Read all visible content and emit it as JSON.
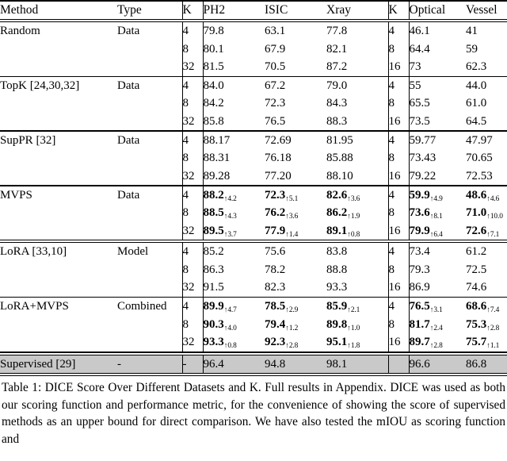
{
  "table": {
    "headers": [
      "Method",
      "Type",
      "K",
      "PH2",
      "ISIC",
      "Xray",
      "K",
      "Optical",
      "Vessel"
    ],
    "groups": [
      {
        "method": "Random",
        "type": "Data",
        "bold": false,
        "rows": [
          {
            "k1": "4",
            "ph2": "79.8",
            "isic": "63.1",
            "xray": "77.8",
            "k2": "4",
            "optical": "46.1",
            "vessel": "41"
          },
          {
            "k1": "8",
            "ph2": "80.1",
            "isic": "67.9",
            "xray": "82.1",
            "k2": "8",
            "optical": "64.4",
            "vessel": "59"
          },
          {
            "k1": "32",
            "ph2": "81.5",
            "isic": "70.5",
            "xray": "87.2",
            "k2": "16",
            "optical": "73",
            "vessel": "62.3"
          }
        ]
      },
      {
        "method": "TopK [24,30,32]",
        "type": "Data",
        "bold": false,
        "rows": [
          {
            "k1": "4",
            "ph2": "84.0",
            "isic": "67.2",
            "xray": "79.0",
            "k2": "4",
            "optical": "55",
            "vessel": "44.0"
          },
          {
            "k1": "8",
            "ph2": "84.2",
            "isic": "72.3",
            "xray": "84.3",
            "k2": "8",
            "optical": "65.5",
            "vessel": "61.0"
          },
          {
            "k1": "32",
            "ph2": "85.8",
            "isic": "76.5",
            "xray": "88.3",
            "k2": "16",
            "optical": "73.5",
            "vessel": "64.5"
          }
        ]
      },
      {
        "method": "SupPR [32]",
        "type": "Data",
        "bold": false,
        "rows": [
          {
            "k1": "4",
            "ph2": "88.17",
            "isic": "72.69",
            "xray": "81.95",
            "k2": "4",
            "optical": "59.77",
            "vessel": "47.97"
          },
          {
            "k1": "8",
            "ph2": "88.31",
            "isic": "76.18",
            "xray": "85.88",
            "k2": "8",
            "optical": "73.43",
            "vessel": "70.65"
          },
          {
            "k1": "32",
            "ph2": "89.28",
            "isic": "77.20",
            "xray": "88.10",
            "k2": "16",
            "optical": "79.22",
            "vessel": "72.53"
          }
        ]
      },
      {
        "method": "MVPS",
        "type": "Data",
        "bold": true,
        "rows": [
          {
            "k1": "4",
            "ph2": "88.2",
            "ph2_d": "4.2",
            "isic": "72.3",
            "isic_d": "5.1",
            "xray": "82.6",
            "xray_d": "3.6",
            "k2": "4",
            "optical": "59.9",
            "optical_d": "4.9",
            "vessel": "48.6",
            "vessel_d": "4.6"
          },
          {
            "k1": "8",
            "ph2": "88.5",
            "ph2_d": "4.3",
            "isic": "76.2",
            "isic_d": "3.6",
            "xray": "86.2",
            "xray_d": "1.9",
            "k2": "8",
            "optical": "73.6",
            "optical_d": "8.1",
            "vessel": "71.0",
            "vessel_d": "10.0"
          },
          {
            "k1": "32",
            "ph2": "89.5",
            "ph2_d": "3.7",
            "isic": "77.9",
            "isic_d": "1.4",
            "xray": "89.1",
            "xray_d": "0.8",
            "k2": "16",
            "optical": "79.9",
            "optical_d": "6.4",
            "vessel": "72.6",
            "vessel_d": "7.1"
          }
        ]
      },
      {
        "method": "LoRA [33,10]",
        "type": "Model",
        "bold": false,
        "rows": [
          {
            "k1": "4",
            "ph2": "85.2",
            "isic": "75.6",
            "xray": "83.8",
            "k2": "4",
            "optical": "73.4",
            "vessel": "61.2"
          },
          {
            "k1": "8",
            "ph2": "86.3",
            "isic": "78.2",
            "xray": "88.8",
            "k2": "8",
            "optical": "79.3",
            "vessel": "72.5"
          },
          {
            "k1": "32",
            "ph2": "91.5",
            "isic": "82.3",
            "xray": "93.3",
            "k2": "16",
            "optical": "86.9",
            "vessel": "74.6"
          }
        ]
      },
      {
        "method": "LoRA+MVPS",
        "type": "Combined",
        "bold": true,
        "rows": [
          {
            "k1": "4",
            "ph2": "89.9",
            "ph2_d": "4.7",
            "isic": "78.5",
            "isic_d": "2.9",
            "xray": "85.9",
            "xray_d": "2.1",
            "k2": "4",
            "optical": "76.5",
            "optical_d": "3.1",
            "vessel": "68.6",
            "vessel_d": "7.4"
          },
          {
            "k1": "8",
            "ph2": "90.3",
            "ph2_d": "4.0",
            "isic": "79.4",
            "isic_d": "1.2",
            "xray": "89.8",
            "xray_d": "1.0",
            "k2": "8",
            "optical": "81.7",
            "optical_d": "2.4",
            "vessel": "75.3",
            "vessel_d": "2.8"
          },
          {
            "k1": "32",
            "ph2": "93.3",
            "ph2_d": "0.8",
            "isic": "92.3",
            "isic_d": "2.8",
            "xray": "95.1",
            "xray_d": "1.8",
            "k2": "16",
            "optical": "89.7",
            "optical_d": "2.8",
            "vessel": "75.7",
            "vessel_d": "1.1"
          }
        ]
      }
    ],
    "supervised": {
      "method": "Supervised [29]",
      "type": "-",
      "k1": "-",
      "ph2": "96.4",
      "isic": "94.8",
      "xray": "98.1",
      "k2": "",
      "optical": "96.6",
      "vessel": "86.8",
      "shade_color": "#c9c9c9"
    },
    "arrow_glyph": "↑"
  },
  "caption": {
    "text": "Table 1: DICE Score Over Different Datasets and K. Full results in Appendix. DICE was used as both our scoring function and performance metric, for the convenience of showing the score of supervised methods as an upper bound for direct comparison. We have also tested the mIOU as scoring function and"
  }
}
